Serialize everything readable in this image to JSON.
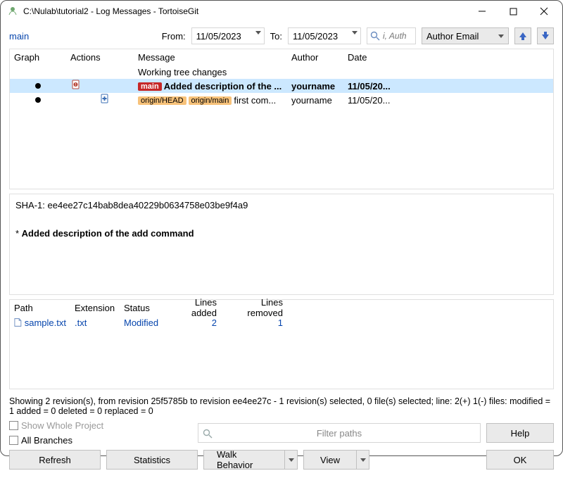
{
  "window": {
    "title": "C:\\Nulab\\tutorial2 - Log Messages - TortoiseGit"
  },
  "filter": {
    "branch": "main",
    "from_label": "From:",
    "from_date": "11/05/2023",
    "to_label": "To:",
    "to_date": "11/05/2023",
    "author_placeholder": "i, Auth",
    "dropdown_label": "Author Email"
  },
  "log": {
    "cols": {
      "graph": "Graph",
      "actions": "Actions",
      "message": "Message",
      "author": "Author",
      "date": "Date"
    },
    "working_tree": "Working tree changes",
    "rows": [
      {
        "tags": [
          {
            "style": "red",
            "text": "main"
          }
        ],
        "msg": "Added description of the ...",
        "author": "yourname",
        "date": "11/05/20..."
      },
      {
        "tags": [
          {
            "style": "org",
            "text": "origin/HEAD"
          },
          {
            "style": "org",
            "text": "origin/main"
          }
        ],
        "msg": "first com...",
        "author": "yourname",
        "date": "11/05/20..."
      }
    ]
  },
  "detail": {
    "sha_label": "SHA-1: ",
    "sha": "ee4ee27c14bab8dea40229b0634758e03be9f4a9",
    "star": "* ",
    "message": "Added description of the add command"
  },
  "files": {
    "cols": {
      "path": "Path",
      "ext": "Extension",
      "status": "Status",
      "la": "Lines added",
      "lr": "Lines removed"
    },
    "rows": [
      {
        "path": "sample.txt",
        "ext": ".txt",
        "status": "Modified",
        "la": "2",
        "lr": "1"
      }
    ]
  },
  "status_line": "Showing 2 revision(s), from revision 25f5785b to revision ee4ee27c - 1 revision(s) selected, 0 file(s) selected; line: 2(+) 1(-) files: modified = 1  added = 0  deleted = 0  replaced = 0",
  "checks": {
    "show_whole": "Show Whole Project",
    "all_branches": "All Branches"
  },
  "filter_paths_placeholder": "Filter paths",
  "buttons": {
    "help": "Help",
    "refresh": "Refresh",
    "statistics": "Statistics",
    "walk": "Walk Behavior",
    "view": "View",
    "ok": "OK"
  }
}
